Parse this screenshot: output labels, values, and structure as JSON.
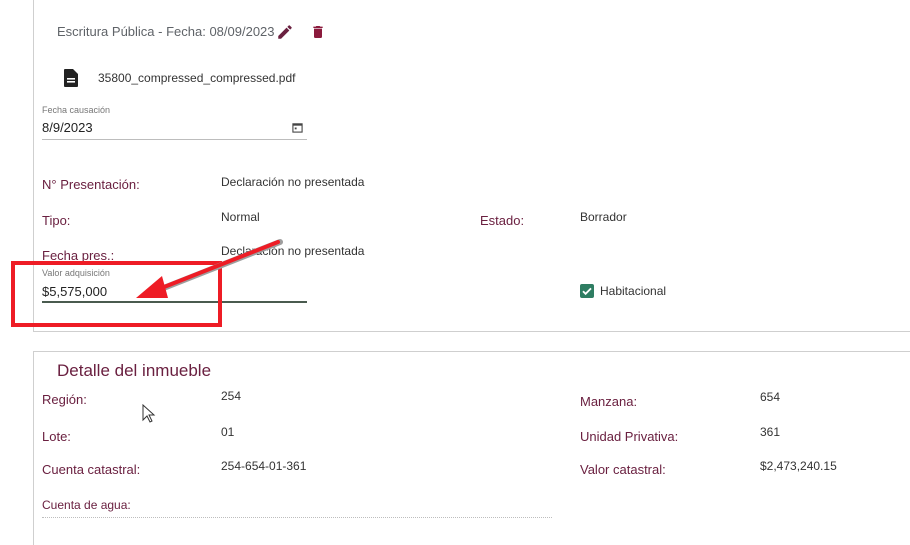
{
  "escritura": {
    "title": "Escritura Pública - Fecha: 08/09/2023",
    "edit_icon": "pencil-icon",
    "delete_icon": "trash-icon"
  },
  "file": {
    "icon": "document-icon",
    "name": "35800_compressed_compressed.pdf"
  },
  "fecha_causacion": {
    "label": "Fecha causación",
    "value": "8/9/2023",
    "icon": "calendar-icon"
  },
  "presentacion": {
    "label": "N° Presentación:",
    "value": "Declaración no presentada"
  },
  "tipo": {
    "label": "Tipo:",
    "value": "Normal"
  },
  "estado": {
    "label": "Estado:",
    "value": "Borrador"
  },
  "fecha_pres": {
    "label": "Fecha pres.:",
    "value": "Declaración no presentada"
  },
  "valor_adquisicion": {
    "label": "Valor adquisición",
    "value": "$5,575,000"
  },
  "habitacional": {
    "label": "Habitacional",
    "checked": true
  },
  "detalle": {
    "title": "Detalle del inmueble",
    "region": {
      "label": "Región:",
      "value": "254"
    },
    "lote": {
      "label": "Lote:",
      "value": "01"
    },
    "cuenta_catastral": {
      "label": "Cuenta catastral:",
      "value": "254-654-01-361"
    },
    "cuenta_agua": {
      "label": "Cuenta de agua:",
      "value": ""
    },
    "manzana": {
      "label": "Manzana:",
      "value": "654"
    },
    "unidad_privativa": {
      "label": "Unidad Privativa:",
      "value": "361"
    },
    "valor_catastral": {
      "label": "Valor catastral:",
      "value": "$2,473,240.15"
    }
  },
  "colors": {
    "label_text": "#6a2040",
    "accent_green": "#2e7d62",
    "annotation_red": "#ee1c25"
  }
}
